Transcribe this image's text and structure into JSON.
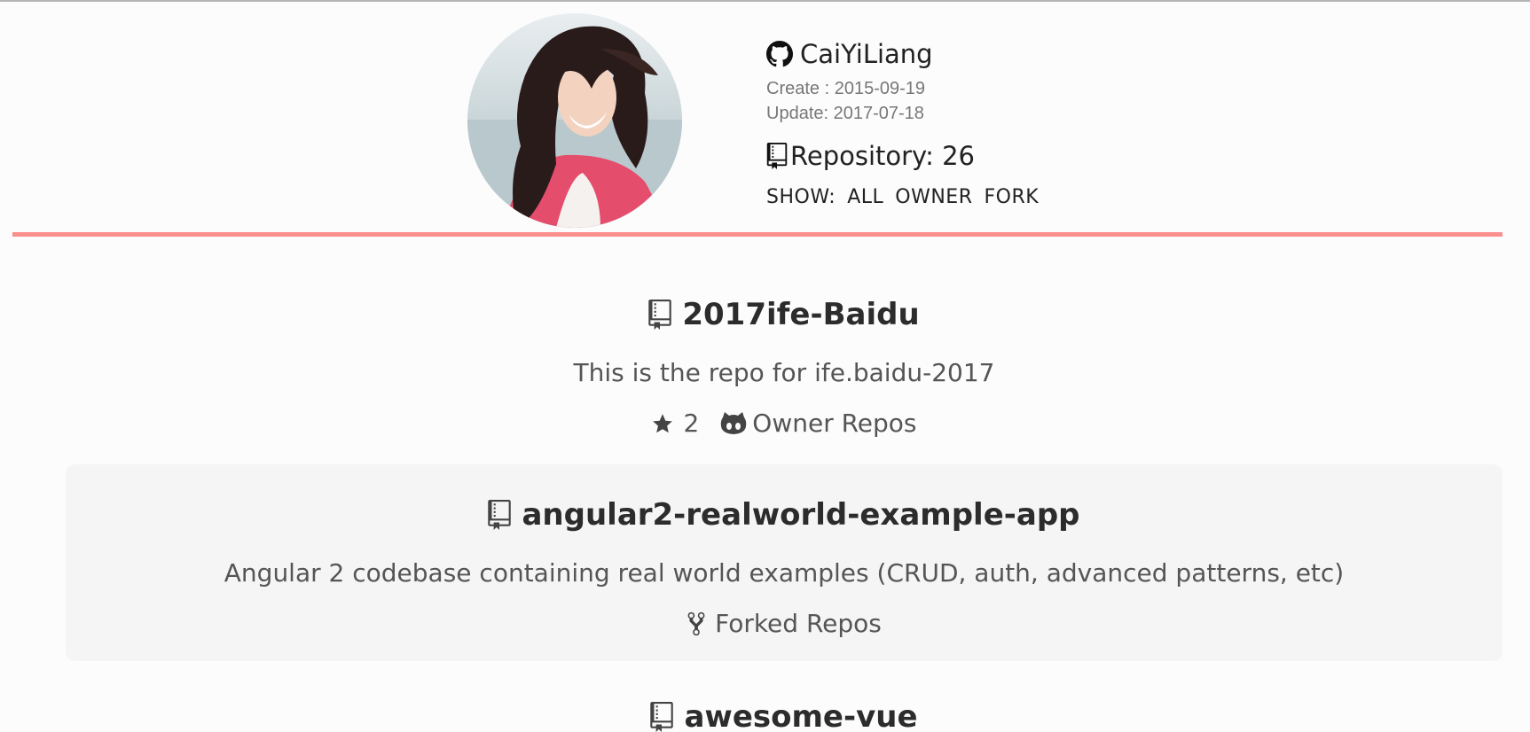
{
  "profile": {
    "username": "CaiYiLiang",
    "created": "Create : 2015-09-19",
    "updated": "Update: 2017-07-18",
    "repository_count": "Repository: 26"
  },
  "filters": {
    "show_label": "SHOW:",
    "all": "ALL",
    "owner": "OWNER",
    "fork": "FORK"
  },
  "repos": [
    {
      "name": "2017ife-Baidu",
      "description": "This is the repo for ife.baidu-2017",
      "stars": "2",
      "type_label": "Owner Repos"
    },
    {
      "name": "angular2-realworld-example-app",
      "description": "Angular 2 codebase containing real world examples (CRUD, auth, advanced patterns, etc)",
      "type_label": "Forked Repos"
    },
    {
      "name": "awesome-vue"
    }
  ],
  "colors": {
    "accent_divider": "#fa8f8d",
    "alt_row_bg": "#f5f5f5"
  },
  "icons": {
    "github": "github-octocat-icon",
    "repo": "repo-book-icon",
    "star": "star-icon",
    "owner": "octoface-icon",
    "fork": "fork-icon"
  }
}
